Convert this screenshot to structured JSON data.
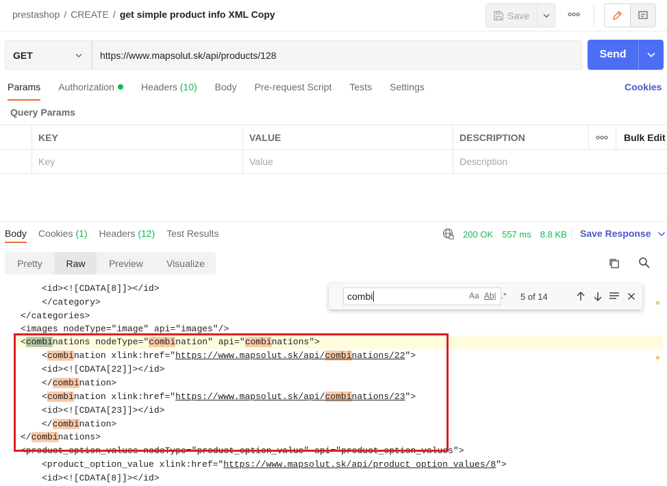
{
  "header": {
    "breadcrumb": [
      "prestashop",
      "CREATE",
      "get simple product info XML Copy"
    ],
    "separator": "/",
    "save_label": "Save",
    "more_icon": "more-dots-icon",
    "edit_icon": "pencil-icon",
    "doc_icon": "comment-icon"
  },
  "request": {
    "method": "GET",
    "url": "https://www.mapsolut.sk/api/products/128",
    "send_label": "Send"
  },
  "request_tabs": [
    {
      "label": "Params",
      "count": ""
    },
    {
      "label": "Authorization",
      "count": ""
    },
    {
      "label": "Headers",
      "count": "(10)"
    },
    {
      "label": "Body",
      "count": ""
    },
    {
      "label": "Pre-request Script",
      "count": ""
    },
    {
      "label": "Tests",
      "count": ""
    },
    {
      "label": "Settings",
      "count": ""
    }
  ],
  "cookies_label": "Cookies",
  "query_params": {
    "title": "Query Params",
    "headers": [
      "KEY",
      "VALUE",
      "DESCRIPTION"
    ],
    "bulk_edit": "Bulk Edit",
    "placeholders": [
      "Key",
      "Value",
      "Description"
    ]
  },
  "response_tabs": [
    {
      "label": "Body",
      "count": ""
    },
    {
      "label": "Cookies",
      "count": "(1)"
    },
    {
      "label": "Headers",
      "count": "(12)"
    },
    {
      "label": "Test Results",
      "count": ""
    }
  ],
  "status": {
    "code": "200 OK",
    "time": "557 ms",
    "size": "8.8 KB",
    "save_response": "Save Response"
  },
  "format_tabs": [
    "Pretty",
    "Raw",
    "Preview",
    "Visualize"
  ],
  "find": {
    "query": "combi",
    "count": "5 of 14",
    "opt_case": "Aa",
    "opt_word": "Ab|",
    "opt_regex": ".*"
  },
  "code": {
    "l1": "<id><![CDATA[8]]></id>",
    "l2": "</category>",
    "l3": "</categories>",
    "l4": "<images nodeType=\"image\" api=\"images\"/>",
    "kw": "combi",
    "l5_a": "<",
    "l5_b": "nations nodeType=\"",
    "l5_c": "nation\" api=\"",
    "l5_d": "nations\">",
    "l6_a": "<",
    "l6_b": "nation xlink:href=\"",
    "l6_url_a": "https://www.mapsolut.sk/api/",
    "l6_url_b": "nations/22",
    "l6_end": "\">",
    "l7": "<id><![CDATA[22]]></id>",
    "l8_a": "</",
    "l8_b": "nation>",
    "l9_url_b": "nations/23",
    "l10": "<id><![CDATA[23]]></id>",
    "l12_b": "nations>",
    "l13": "<product_option_values nodeType=\"product_option_value\" api=\"product_option_values\">",
    "l14_a": "<product_option_value xlink:href=\"",
    "l14_url": "https://www.mapsolut.sk/api/product_option_values/8",
    "l14_end": "\">",
    "l15": "<id><![CDATA[8]]></id>"
  }
}
